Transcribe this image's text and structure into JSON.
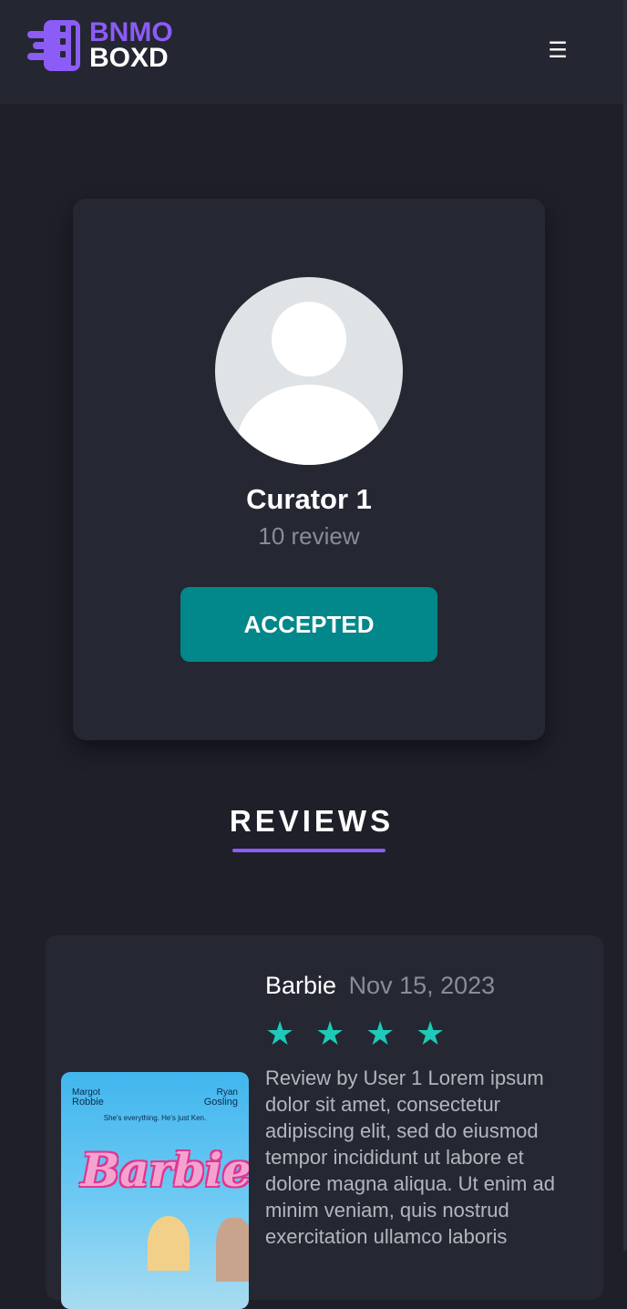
{
  "header": {
    "logo_line1": "BNMO",
    "logo_line2": "BOXD",
    "menu_icon": "☰"
  },
  "profile": {
    "name": "Curator 1",
    "review_count": "10 review",
    "status_button": "ACCEPTED"
  },
  "reviews_section": {
    "title": "REVIEWS",
    "items": [
      {
        "movie_title": "Barbie",
        "date": "Nov 15, 2023",
        "rating": 4,
        "text": "Review by User 1 Lorem ipsum dolor sit amet, consectetur adipiscing elit, sed do eiusmod tempor incididunt ut labore et dolore magna aliqua. Ut enim ad minim veniam, quis nostrud exercitation ullamco laboris",
        "poster": {
          "actor_left_first": "Margot",
          "actor_left_last": "Robbie",
          "actor_right_first": "Ryan",
          "actor_right_last": "Gosling",
          "tagline": "She's everything. He's just Ken.",
          "brand": "Barbie"
        }
      }
    ]
  },
  "colors": {
    "accent_purple": "#8b5cf6",
    "accepted_teal": "#02878a",
    "star_teal": "#1ec9b7",
    "background": "#1e1f29",
    "card": "#252733"
  }
}
